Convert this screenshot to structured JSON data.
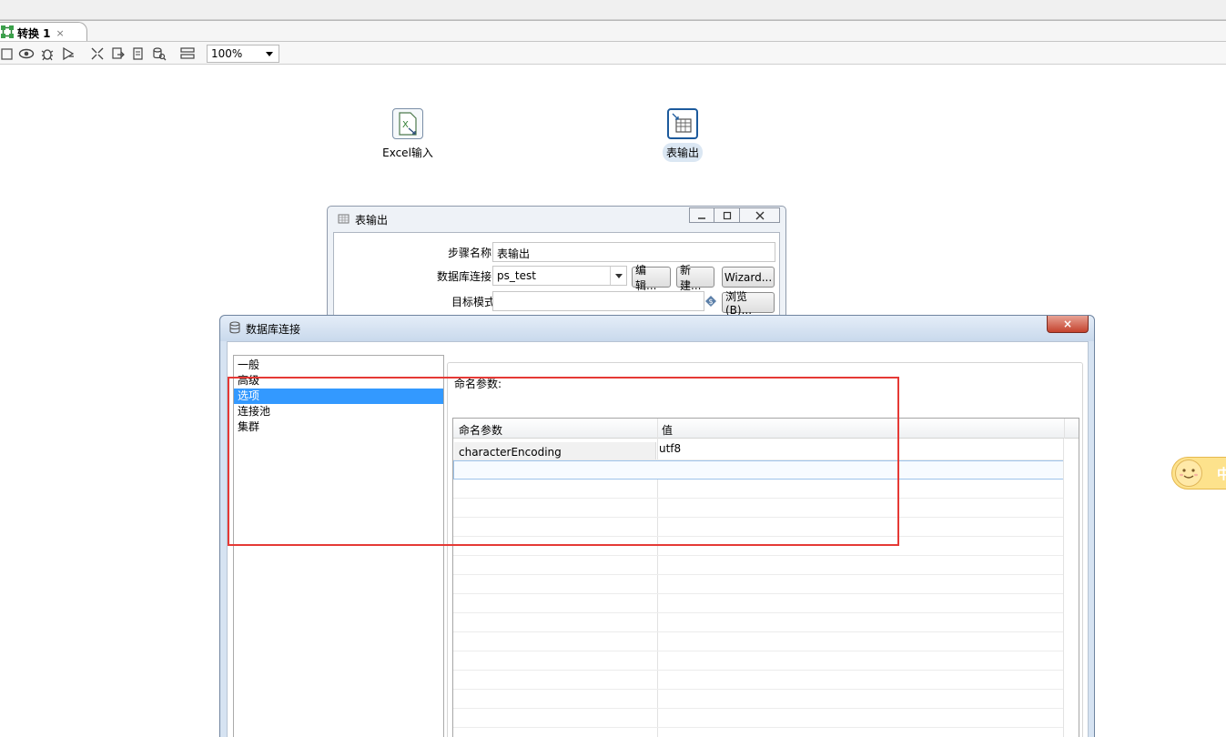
{
  "tab": {
    "title": "转换 1",
    "close_icon": "×"
  },
  "toolbar": {
    "zoom": "100%"
  },
  "canvas": {
    "steps": [
      {
        "label": "Excel输入",
        "icon": "excel-input-icon"
      },
      {
        "label": "表输出",
        "icon": "table-output-icon"
      }
    ]
  },
  "table_output_dialog": {
    "title": "表输出",
    "rows": [
      {
        "label": "步骤名称",
        "value": "表输出"
      },
      {
        "label": "数据库连接",
        "value": "ps_test"
      },
      {
        "label": "目标模式",
        "value": ""
      }
    ],
    "buttons": {
      "edit": "编辑...",
      "new": "新建...",
      "wizard": "Wizard...",
      "browse": "浏览(B)..."
    }
  },
  "db_dialog": {
    "title": "数据库连接",
    "close_label": "×",
    "nav": [
      "一般",
      "高级",
      "选项",
      "连接池",
      "集群"
    ],
    "selected_nav": 2,
    "named_params_label": "命名参数:",
    "table": {
      "headers": [
        "命名参数",
        "值"
      ],
      "rows": [
        {
          "key": "characterEncoding",
          "value": "utf8"
        }
      ]
    }
  },
  "ime": {
    "char": "中"
  },
  "colors": {
    "selection": "#3399ff",
    "annotation": "#e53935",
    "close_button": "#c4432e"
  }
}
